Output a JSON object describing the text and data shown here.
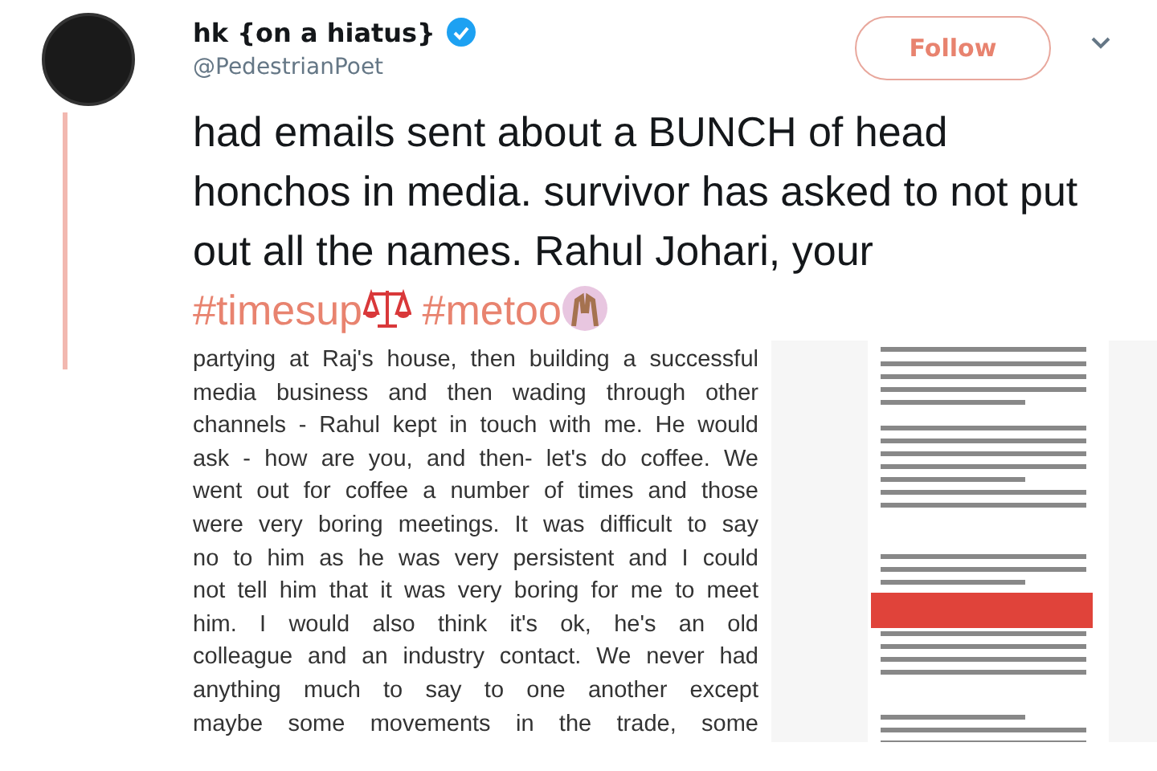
{
  "author": {
    "name": "hk {on a hiatus}",
    "handle": "@PedestrianPoet",
    "verified": true
  },
  "follow_button": {
    "label": "Follow"
  },
  "tweet": {
    "parts": [
      {
        "kind": "text",
        "text": "had emails sent about a BUNCH of head honchos in media. survivor has asked to not put out all the names. Rahul Johari, your "
      },
      {
        "kind": "hashtag",
        "text": "#timesup"
      },
      {
        "kind": "hashtag",
        "text": "#metoo"
      }
    ]
  },
  "attached_document": {
    "lines": [
      "partying at Raj's house, then building a successful",
      "media business and then wading through other",
      "channels - Rahul kept in touch with me. He would",
      "ask - how are you, and then- let's do coffee. We",
      "went out for coffee a number of times and those",
      "were very boring meetings. It was difficult to say",
      "no to him as he was very persistent and I could",
      "not tell him that it was very boring for me to meet",
      "him. I would also think it's ok, he's an old",
      "colleague and an industry contact. We never had",
      "anything much to say to one another except",
      "maybe some movements in the trade, some"
    ]
  }
}
